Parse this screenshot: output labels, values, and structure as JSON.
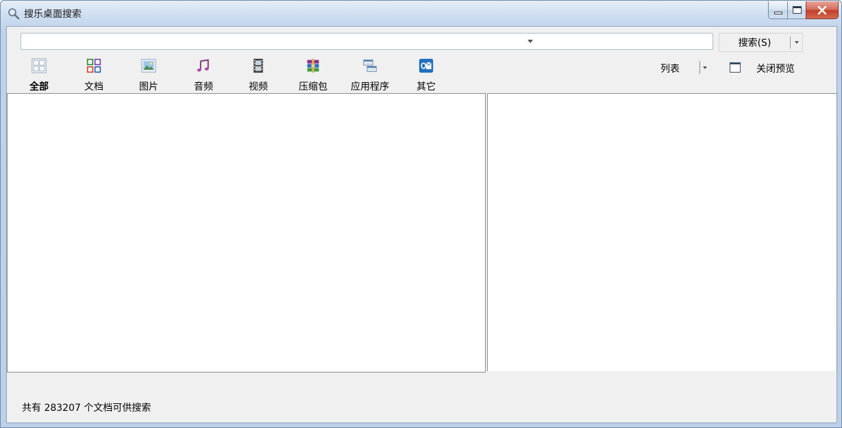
{
  "window": {
    "title": "搜乐桌面搜索"
  },
  "search": {
    "value": "",
    "placeholder": "",
    "button_label": "搜索(S)"
  },
  "categories": [
    {
      "label": "全部",
      "icon": "all-grid-icon",
      "active": true
    },
    {
      "label": "文档",
      "icon": "document-icon",
      "active": false
    },
    {
      "label": "图片",
      "icon": "picture-icon",
      "active": false
    },
    {
      "label": "音频",
      "icon": "music-note-icon",
      "active": false
    },
    {
      "label": "视频",
      "icon": "film-icon",
      "active": false
    },
    {
      "label": "压缩包",
      "icon": "archive-icon",
      "active": false
    },
    {
      "label": "应用程序",
      "icon": "application-icon",
      "active": false
    },
    {
      "label": "其它",
      "icon": "outlook-icon",
      "active": false
    }
  ],
  "toolbar": {
    "view_mode": "列表",
    "close_preview": "关闭预览"
  },
  "status": {
    "text": "共有 283207 个文档可供搜索"
  },
  "colors": {
    "title_bar": "#cfdff1",
    "close_button": "#c2402c",
    "client_background": "#f0f0f0"
  }
}
